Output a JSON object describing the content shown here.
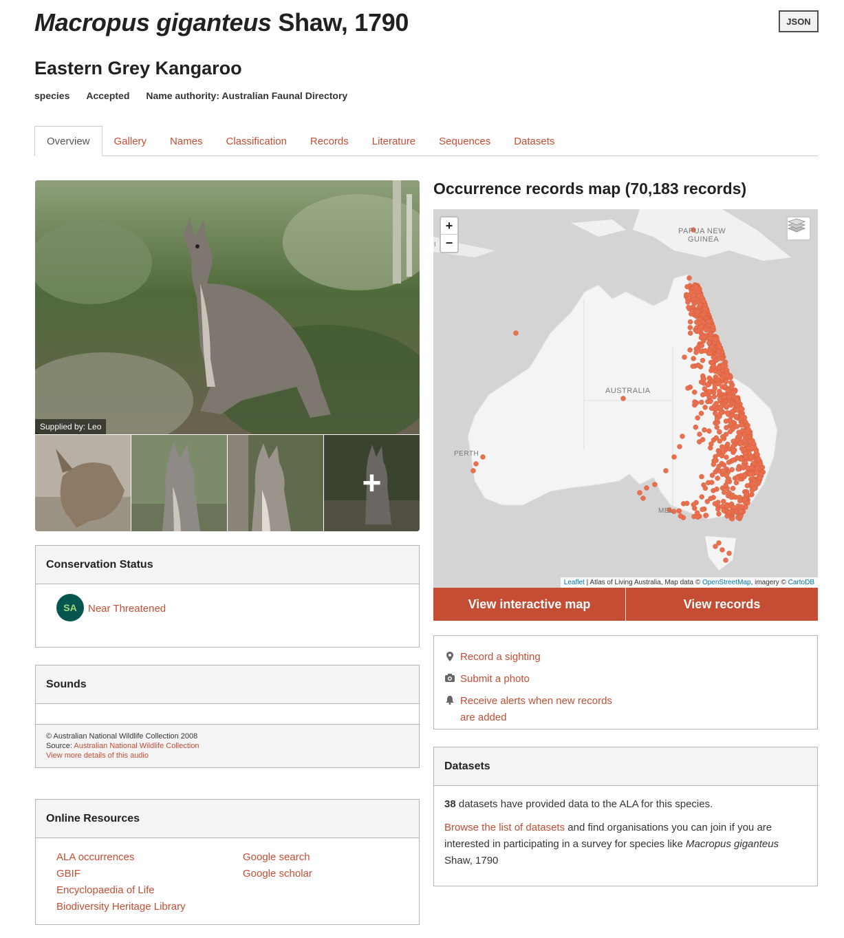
{
  "header": {
    "scientific_name": "Macropus giganteus",
    "authority": "Shaw, 1790",
    "json_button": "JSON",
    "common_name": "Eastern Grey Kangaroo",
    "rank": "species",
    "status": "Accepted",
    "name_authority": "Name authority: Australian Faunal Directory"
  },
  "tabs": [
    {
      "label": "Overview",
      "active": true
    },
    {
      "label": "Gallery"
    },
    {
      "label": "Names"
    },
    {
      "label": "Classification"
    },
    {
      "label": "Records"
    },
    {
      "label": "Literature"
    },
    {
      "label": "Sequences"
    },
    {
      "label": "Datasets"
    }
  ],
  "gallery": {
    "caption": "Supplied by: Leo",
    "more_symbol": "+"
  },
  "conservation": {
    "title": "Conservation Status",
    "badge": "SA",
    "status": "Near Threatened"
  },
  "sounds": {
    "title": "Sounds",
    "copyright": "© Australian National Wildlife Collection 2008",
    "source_prefix": "Source: ",
    "source_link": "Australian National Wildlife Collection",
    "details_link": "View more details of this audio"
  },
  "online_resources": {
    "title": "Online Resources",
    "col1": [
      "ALA occurrences",
      "GBIF",
      "Encyclopaedia of Life",
      "Biodiversity Heritage Library"
    ],
    "col2": [
      "Google search",
      "Google scholar"
    ]
  },
  "map": {
    "title": "Occurrence records map (70,183 records)",
    "zoom_in": "+",
    "zoom_out": "−",
    "labels": {
      "png": "PAPUA NEW",
      "png2": "GUINEA",
      "aus": "AUSTRALIA",
      "perth": "PERTH",
      "mel": "MEL",
      "edge": "I"
    },
    "attribution": {
      "leaflet": "Leaflet",
      "mid": " | Atlas of Living Australia, Map data © ",
      "osm": "OpenStreetMap",
      "mid2": ", imagery © ",
      "carto": "CartoDB"
    },
    "point_color": "#e8704f",
    "btn_interactive": "View interactive map",
    "btn_records": "View records"
  },
  "actions": {
    "record": "Record a sighting",
    "photo": "Submit a photo",
    "alerts_line1": "Receive alerts when new records",
    "alerts_line2": "are added"
  },
  "datasets": {
    "title": "Datasets",
    "count": "38",
    "count_text": " datasets have provided data to the ALA for this species.",
    "browse_link": "Browse the list of datasets",
    "browse_text": " and find organisations you can join if you are interested in participating in a survey for species like ",
    "species_italic": "Macropus giganteus",
    "species_tail": " Shaw, 1790"
  }
}
